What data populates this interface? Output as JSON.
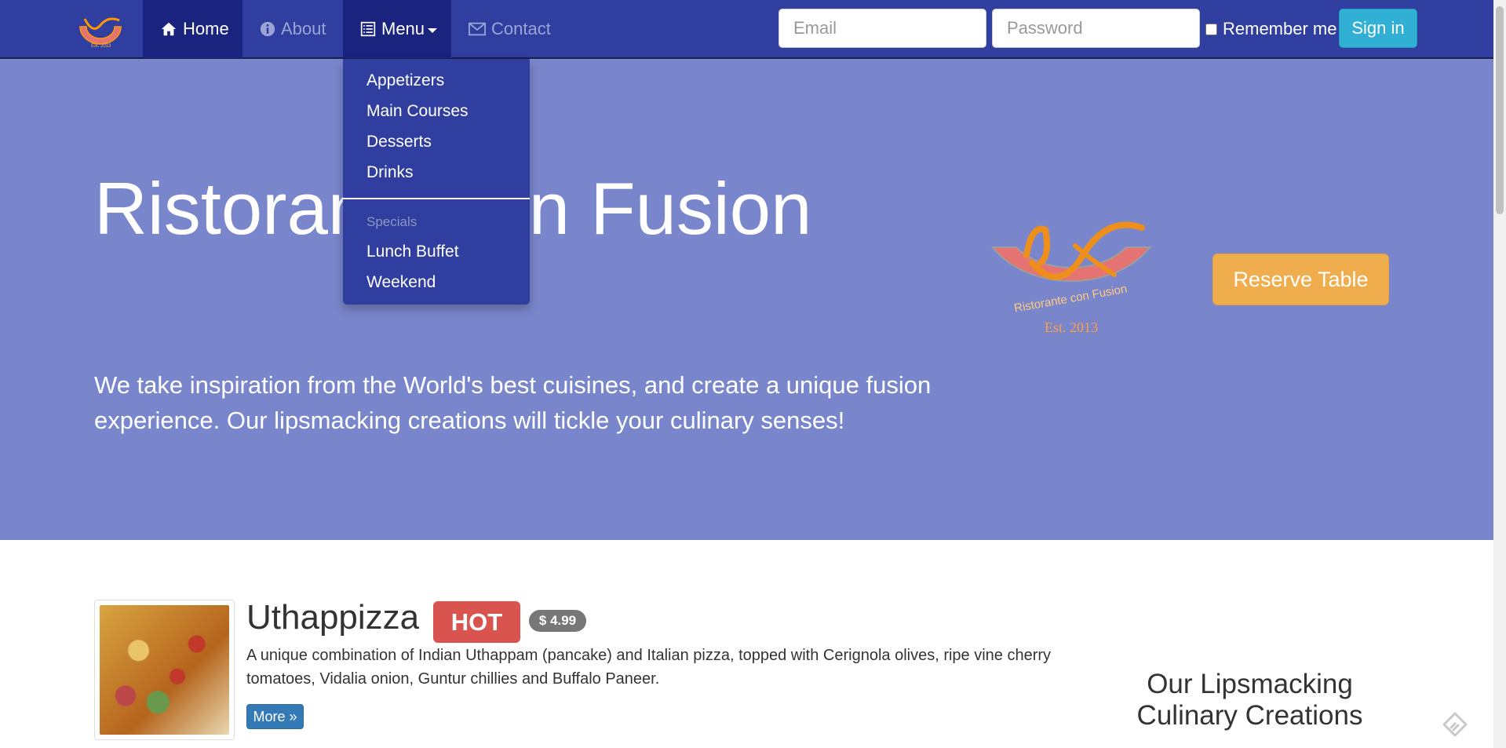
{
  "navbar": {
    "brand_logo": "ristorante-logo",
    "items": [
      {
        "label": "Home",
        "icon": "home-icon",
        "active": true
      },
      {
        "label": "About",
        "icon": "info-icon",
        "active": false
      },
      {
        "label": "Menu",
        "icon": "list-icon",
        "active": false,
        "open": true
      },
      {
        "label": "Contact",
        "icon": "envelope-icon",
        "active": false
      }
    ],
    "login": {
      "email_placeholder": "Email",
      "password_placeholder": "Password",
      "remember_label": "Remember me",
      "signin_label": "Sign in"
    }
  },
  "menu_dropdown": {
    "items": [
      "Appetizers",
      "Main Courses",
      "Desserts",
      "Drinks"
    ],
    "header": "Specials",
    "specials": [
      "Lunch Buffet",
      "Weekend"
    ]
  },
  "hero": {
    "title": "Ristorante con Fusion",
    "text": "We take inspiration from the World's best cuisines, and create a unique fusion experience. Our lipsmacking creations will tickle your culinary senses!",
    "logo_text": "Ristorante con Fusion",
    "logo_est": "Est. 2013",
    "reserve_label": "Reserve Table"
  },
  "featured_dish": {
    "name": "Uthappizza",
    "badge": "HOT",
    "price": "$ 4.99",
    "description": "A unique combination of Indian Uthappam (pancake) and Italian pizza, topped with Cerignola olives, ripe vine cherry tomatoes, Vidalia onion, Guntur chillies and Buffalo Paneer.",
    "more_label": "More »"
  },
  "sidebar": {
    "heading": "Our Lipsmacking Culinary Creations"
  },
  "colors": {
    "navbar": "#303f9f",
    "navbar_active": "#1a237e",
    "hero": "#7986cb",
    "signin": "#31b0d5",
    "reserve": "#f0ad4e",
    "hot_badge": "#d9534f",
    "more_button": "#337ab7"
  }
}
